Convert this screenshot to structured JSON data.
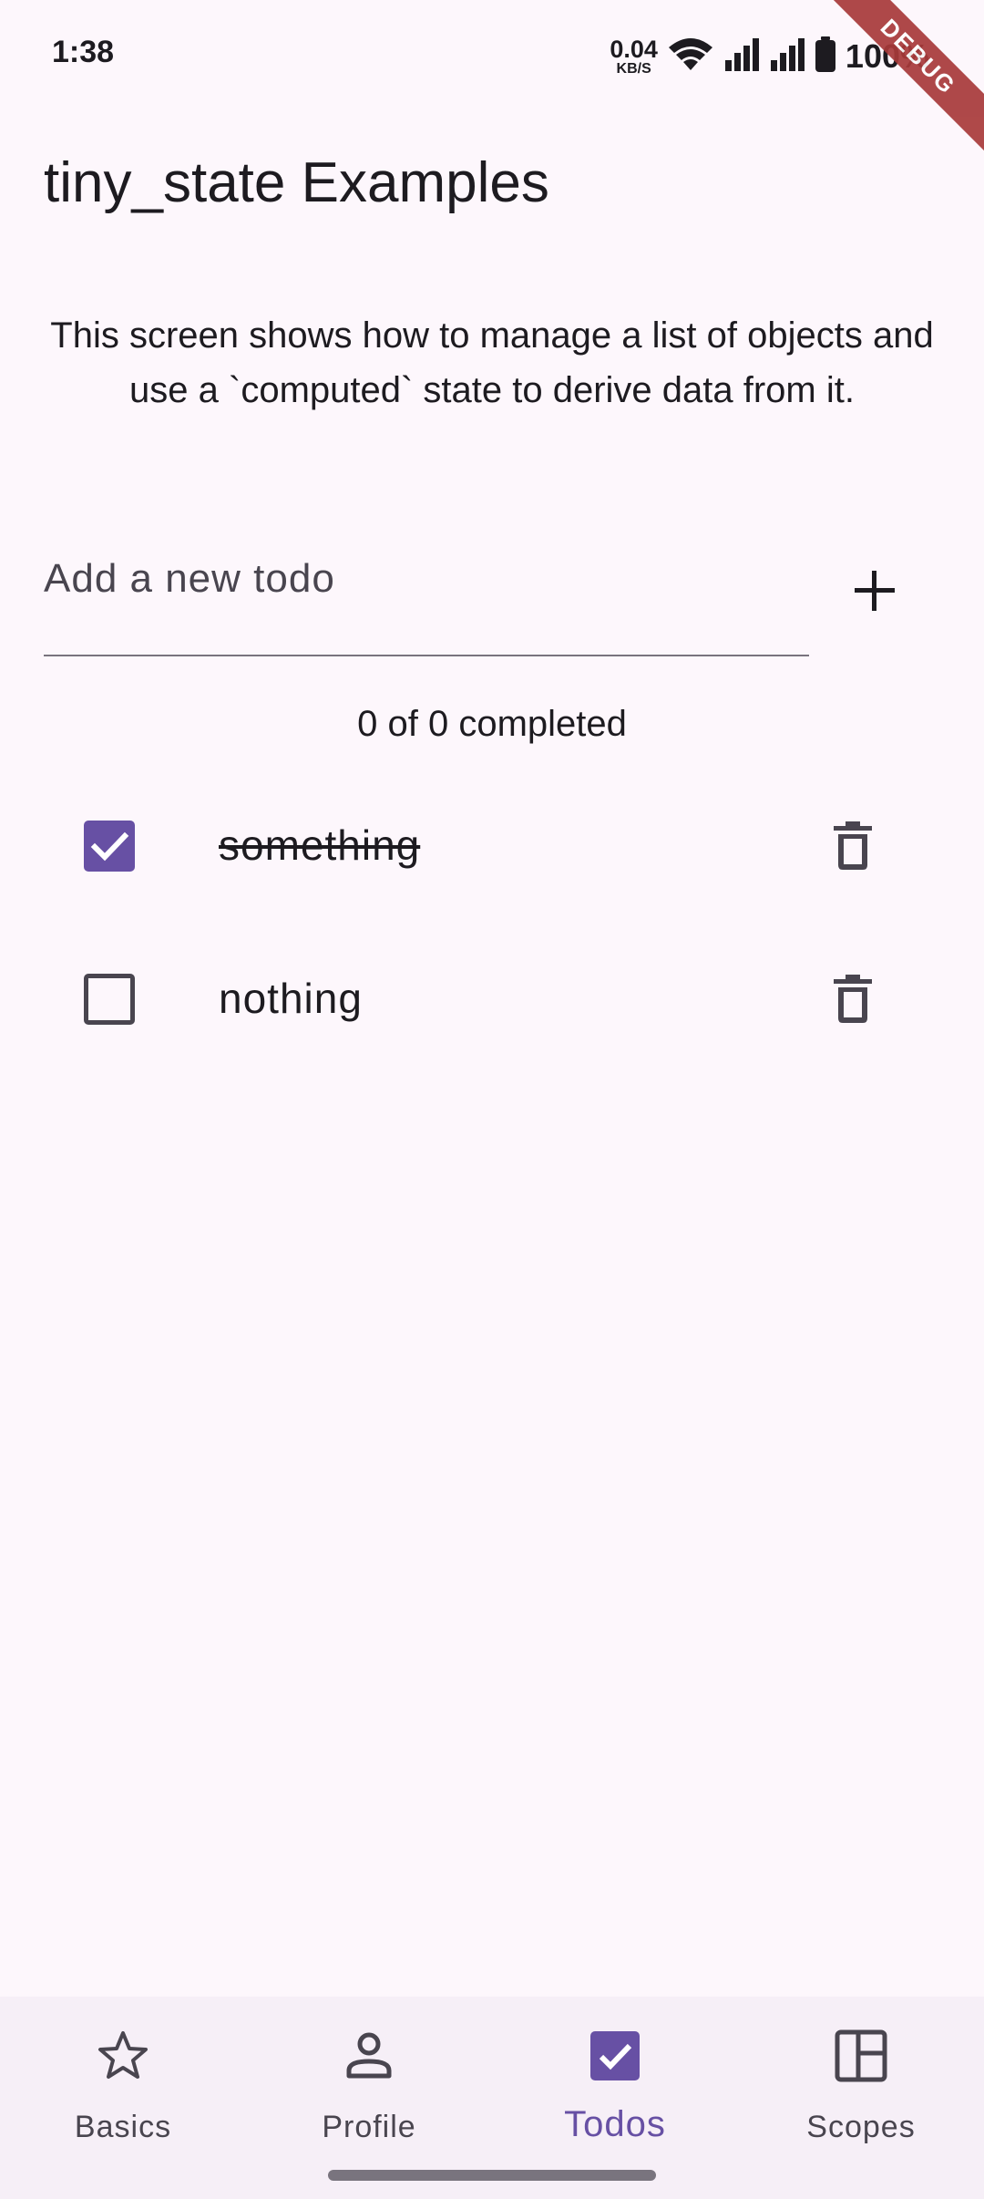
{
  "status_bar": {
    "time": "1:38",
    "net_speed_value": "0.04",
    "net_speed_unit": "KB/S",
    "battery": "100%",
    "icons": [
      "wifi-icon",
      "signal-icon",
      "signal-icon",
      "battery-icon"
    ]
  },
  "debug_banner": "DEBUG",
  "app_bar": {
    "title": "tiny_state Examples"
  },
  "description": "This screen shows how to manage a list of objects and use a `computed` state to derive data from it.",
  "new_todo": {
    "placeholder": "Add a new todo",
    "value": "",
    "add_icon": "plus-icon"
  },
  "summary": "0 of 0 completed",
  "todos": [
    {
      "label": "something",
      "completed": true
    },
    {
      "label": "nothing",
      "completed": false
    }
  ],
  "bottom_nav": {
    "selected": "Todos",
    "items": [
      {
        "label": "Basics",
        "icon": "star-icon"
      },
      {
        "label": "Profile",
        "icon": "person-icon"
      },
      {
        "label": "Todos",
        "icon": "checkbox-icon"
      },
      {
        "label": "Scopes",
        "icon": "dashboard-icon"
      }
    ]
  },
  "colors": {
    "primary": "#6750a4",
    "background": "#fdf7fc",
    "nav_background": "#f6eff7",
    "on_surface": "#1d1b20",
    "on_surface_variant": "#49454f",
    "debug_banner": "#a83a3a"
  }
}
